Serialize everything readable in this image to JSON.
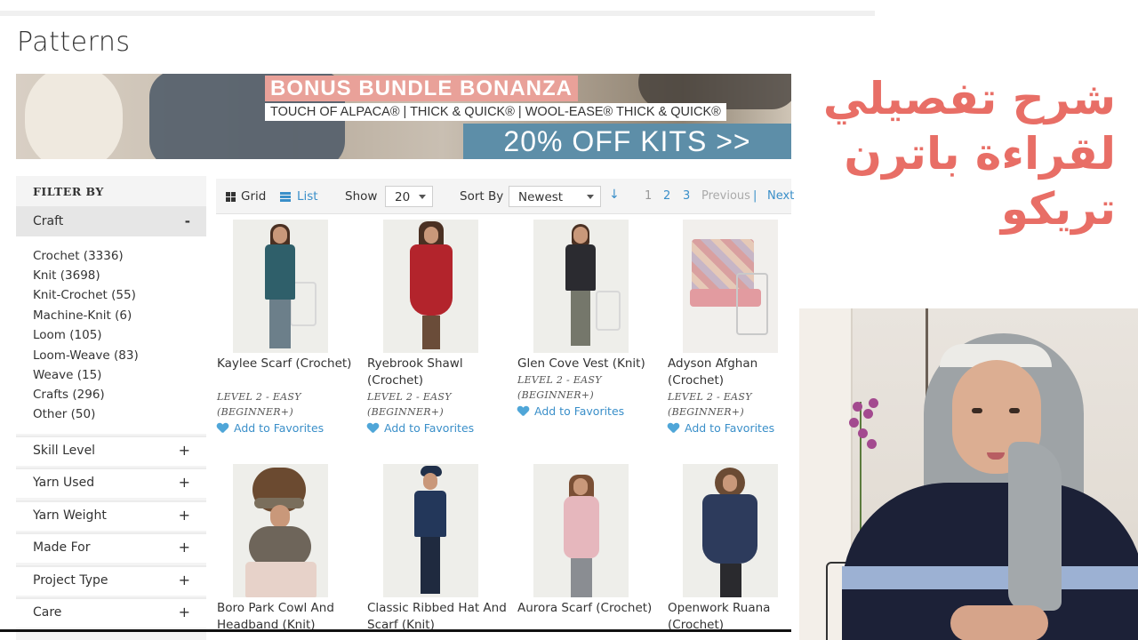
{
  "page": {
    "title": "Patterns"
  },
  "banner": {
    "headline": "BONUS BUNDLE BONANZA",
    "brands": "TOUCH OF ALPACA® | THICK & QUICK® | WOOL-EASE® THICK & QUICK®",
    "offer": "20% OFF KITS >>"
  },
  "sidebar": {
    "filter_by": "FILTER BY",
    "craft": {
      "label": "Craft",
      "toggle": "-",
      "options": [
        "Crochet (3336)",
        "Knit (3698)",
        "Knit-Crochet (55)",
        "Machine-Knit (6)",
        "Loom (105)",
        "Loom-Weave (83)",
        "Weave (15)",
        "Crafts (296)",
        "Other (50)"
      ]
    },
    "facets": [
      {
        "label": "Skill Level",
        "toggle": "+"
      },
      {
        "label": "Yarn Used",
        "toggle": "+"
      },
      {
        "label": "Yarn Weight",
        "toggle": "+"
      },
      {
        "label": "Made For",
        "toggle": "+"
      },
      {
        "label": "Project Type",
        "toggle": "+"
      },
      {
        "label": "Care",
        "toggle": "+"
      }
    ]
  },
  "toolbar": {
    "grid_label": "Grid",
    "list_label": "List",
    "show_label": "Show",
    "show_value": "20",
    "sort_label": "Sort By",
    "sort_value": "Newest",
    "pages": [
      "1",
      "2",
      "3"
    ],
    "previous": "Previous",
    "separator": "|",
    "next": "Next"
  },
  "products": [
    {
      "name": "Kaylee Scarf (Crochet)",
      "level1": "LEVEL 2 - EASY",
      "level2": "(BEGINNER+)",
      "fav": "Add to Favorites"
    },
    {
      "name": "Ryebrook Shawl (Crochet)",
      "level1": "LEVEL 2 - EASY",
      "level2": "(BEGINNER+)",
      "fav": "Add to Favorites"
    },
    {
      "name": "Glen Cove Vest (Knit)",
      "level1": "LEVEL 2 - EASY",
      "level2": "(BEGINNER+)",
      "fav": "Add to Favorites"
    },
    {
      "name": "Adyson Afghan (Crochet)",
      "level1": "LEVEL 2 - EASY",
      "level2": "(BEGINNER+)",
      "fav": "Add to Favorites"
    },
    {
      "name": "Boro Park Cowl And Headband (Knit)"
    },
    {
      "name": "Classic Ribbed Hat And Scarf (Knit)"
    },
    {
      "name": "Aurora Scarf (Crochet)"
    },
    {
      "name": "Openwork Ruana (Crochet)"
    }
  ],
  "overlay": {
    "lines": [
      "شرح تفصيلي",
      "لقراءة باترن",
      "تريكو"
    ]
  },
  "colors": {
    "accent": "#3a8fc9",
    "banner_pink": "#e9a199",
    "banner_blue": "#5d8ea8",
    "arabic_text": "#e86e66"
  }
}
